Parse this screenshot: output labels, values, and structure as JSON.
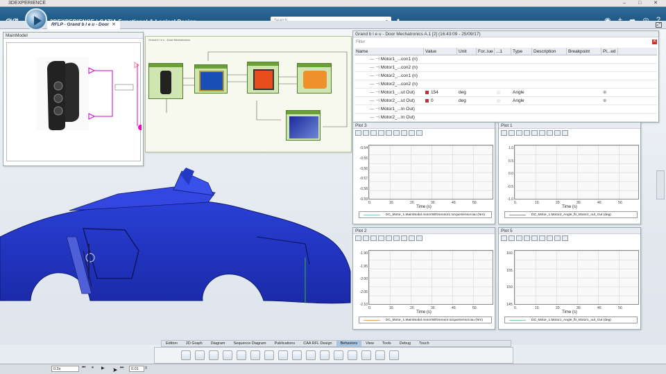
{
  "window": {
    "title": "3DEXPERIENCE",
    "controls": [
      "–",
      "□",
      "✕"
    ]
  },
  "topbar": {
    "brand": "3DEXPERIENCE | CATIA Functional & Logical Design",
    "brand_prefix": "3DEXPERIENCE",
    "brand_app": "CATIA Functional & Logical Design",
    "search_placeholder": "Search",
    "icons": [
      "user-icon",
      "add-icon",
      "share-icon",
      "broadcast-icon",
      "help-icon"
    ]
  },
  "document_tab": {
    "label": "RFLP - Grand b l e u - Door",
    "close": "✕"
  },
  "main_model": {
    "title": "MainModel"
  },
  "diagram": {
    "header": "Grand b l e u - Door Mechatronics"
  },
  "params": {
    "title": "Grand b l e u - Door Mechatronics A.1 [2] (16:43:09 - 25/09/17)",
    "filter_label": "Filter",
    "columns": [
      "Name",
      "Value",
      "Unit",
      "For..lue",
      "...1",
      "Type",
      "Description",
      "Breakpoint",
      "Pl...ed"
    ],
    "rows": [
      {
        "name": "Motor1_...con1 (n)",
        "value": "",
        "unit": "",
        "type": "",
        "locked": false,
        "starred": false
      },
      {
        "name": "Motor1_...con2 (n)",
        "value": "",
        "unit": "",
        "type": "",
        "locked": false,
        "starred": false
      },
      {
        "name": "Motor2_...con1 (n)",
        "value": "",
        "unit": "",
        "type": "",
        "locked": false,
        "starred": false
      },
      {
        "name": "Motor2_...con2 (n)",
        "value": "",
        "unit": "",
        "type": "",
        "locked": false,
        "starred": false
      },
      {
        "name": "Motor1_...ut Out)",
        "value": "154",
        "unit": "deg",
        "type": "Angle",
        "locked": true,
        "starred": true
      },
      {
        "name": "Motor2_...ut Out)",
        "value": "0",
        "unit": "deg",
        "type": "Angle",
        "locked": true,
        "starred": true
      },
      {
        "name": "Motor1_...In Out)",
        "value": "",
        "unit": "",
        "type": "",
        "locked": false,
        "starred": false
      },
      {
        "name": "Motor2_...In Out)",
        "value": "",
        "unit": "",
        "type": "",
        "locked": false,
        "starred": false
      }
    ]
  },
  "plots": [
    {
      "title": "Plot 3",
      "yticks": [
        "-0.54",
        "-0.55",
        "-0.56",
        "-0.57",
        "-0.58",
        "-0.59"
      ],
      "xticks": [
        "0.",
        "10.",
        "20.",
        "30.",
        "40.",
        "50."
      ],
      "xlabel": "Time (s)",
      "legend": "DC_Motor_1.MainModel.motorWithSensor1.torqueSensor.tau (Nm)",
      "color": "#7cc8c8"
    },
    {
      "title": "Plot 1",
      "yticks": [
        "1.0",
        "0.5",
        "0.0",
        "-0.5",
        "-1.0"
      ],
      "xticks": [
        "0.",
        "10.",
        "20.",
        "30.",
        "40.",
        "50."
      ],
      "xlabel": "Time (s)",
      "legend": "DC_Motor_1.Motor2_Angle_fb_Motor2_out_Out (deg)",
      "color": "#888888"
    },
    {
      "title": "Plot 2",
      "yticks": [
        "-1.90",
        "-1.95",
        "-2.00",
        "-2.05",
        "-2.10"
      ],
      "xticks": [
        "0.",
        "10.",
        "20.",
        "30.",
        "40.",
        "50."
      ],
      "xlabel": "Time (s)",
      "legend": "DC_Motor_1.MainModel.motorWithSensor.torqueSensor.tau (Nm)",
      "color": "#e0a060"
    },
    {
      "title": "Plot 5",
      "yticks": [
        "160.",
        "155.",
        "150.",
        "145."
      ],
      "xticks": [
        "0.",
        "10.",
        "20.",
        "30.",
        "40.",
        "50."
      ],
      "xlabel": "Time (s)",
      "legend": "DC_Motor_1.Motor1_Angle_fb_Motor1_out_Out (deg)",
      "color": "#7cc8a0"
    }
  ],
  "bottom_tabs": [
    "Edition",
    "2D Graph",
    "Diagram",
    "Sequence Diagram",
    "Publications",
    "CAA RFL Design",
    "Behaviors",
    "View",
    "Tools",
    "Debug",
    "Touch"
  ],
  "active_bottom_tab": "Behaviors",
  "timebar": {
    "time_value": "0.2s",
    "step_value": "0.01"
  }
}
